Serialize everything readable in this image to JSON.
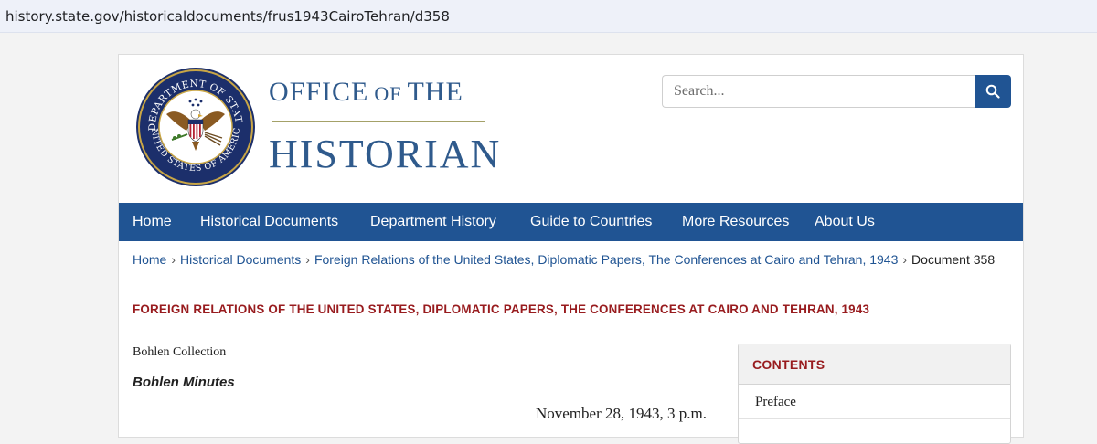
{
  "browser": {
    "url": "history.state.gov/historicaldocuments/frus1943CairoTehran/d358"
  },
  "brand": {
    "line1_a": "OFFICE",
    "line1_of": "OF",
    "line1_b": "THE",
    "line2": "HISTORIAN",
    "seal_icon": "department-of-state-seal",
    "seal_text_top": "DEPARTMENT OF STATE",
    "seal_text_bottom": "UNITED STATES OF AMERICA",
    "colors": {
      "navy": "#2f5a8c",
      "gold": "#a4a168"
    }
  },
  "search": {
    "placeholder": "Search...",
    "button_icon": "search-icon"
  },
  "nav": {
    "items": [
      {
        "label": "Home"
      },
      {
        "label": "Historical Documents"
      },
      {
        "label": "Department History"
      },
      {
        "label": "Guide to Countries"
      },
      {
        "label": "More Resources"
      },
      {
        "label": "About Us"
      }
    ],
    "color": "#205493"
  },
  "breadcrumb": {
    "items": [
      {
        "label": "Home"
      },
      {
        "label": "Historical Documents"
      },
      {
        "label": "Foreign Relations of the United States, Diplomatic Papers, The Conferences at Cairo and Tehran, 1943"
      }
    ],
    "current": "Document 358",
    "separator": "›"
  },
  "document": {
    "volume_title": "FOREIGN RELATIONS OF THE UNITED STATES, DIPLOMATIC PAPERS, THE CONFERENCES AT CAIRO AND TEHRAN, 1943",
    "collection": "Bohlen Collection",
    "heading": "Bohlen Minutes",
    "date": "November 28, 1943, 3 p.m.",
    "accent_color": "#981b1e"
  },
  "sidebar": {
    "contents_title": "CONTENTS",
    "items": [
      {
        "label": "Preface"
      }
    ]
  }
}
